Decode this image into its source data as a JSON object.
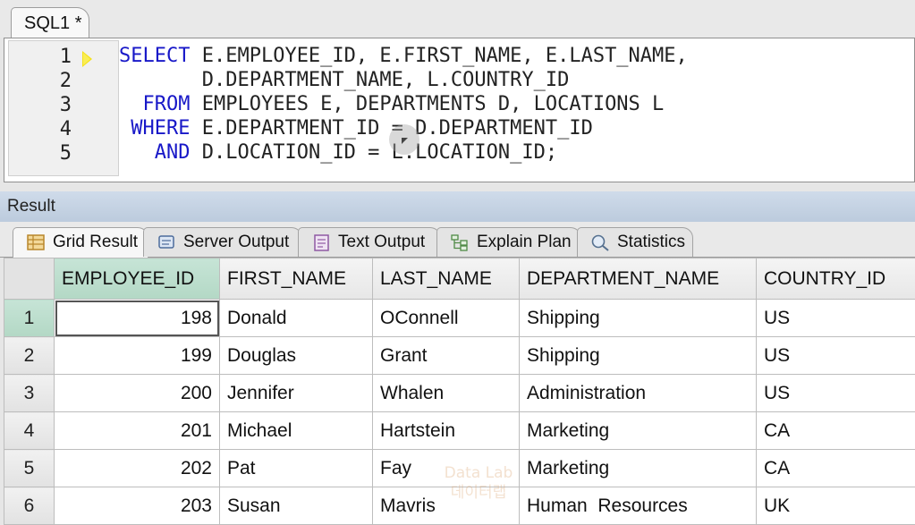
{
  "editor": {
    "tab_label": "SQL1 *",
    "line_numbers": [
      "1",
      "2",
      "3",
      "4",
      "5"
    ],
    "lines": [
      {
        "indent": "",
        "keyword": "SELECT",
        "text": " E.EMPLOYEE_ID, E.FIRST_NAME, E.LAST_NAME,"
      },
      {
        "indent": "       ",
        "keyword": "",
        "text": "D.DEPARTMENT_NAME, L.COUNTRY_ID"
      },
      {
        "indent": "  ",
        "keyword": "FROM",
        "text": " EMPLOYEES E, DEPARTMENTS D, LOCATIONS L"
      },
      {
        "indent": " ",
        "keyword": "WHERE",
        "text": " E.DEPARTMENT_ID = D.DEPARTMENT_ID"
      },
      {
        "indent": "   ",
        "keyword": "AND",
        "text": " D.LOCATION_ID = L.LOCATION_ID;"
      }
    ],
    "keyword_color": "#1818c8"
  },
  "result": {
    "label": "Result",
    "tabs": [
      {
        "label": "Grid Result",
        "icon": "grid-icon"
      },
      {
        "label": "Server Output",
        "icon": "server-icon"
      },
      {
        "label": "Text Output",
        "icon": "text-document-icon"
      },
      {
        "label": "Explain Plan",
        "icon": "explain-plan-icon"
      },
      {
        "label": "Statistics",
        "icon": "statistics-icon"
      }
    ],
    "active_tab": "Grid Result"
  },
  "grid": {
    "columns": [
      "EMPLOYEE_ID",
      "FIRST_NAME",
      "LAST_NAME",
      "DEPARTMENT_NAME",
      "COUNTRY_ID"
    ],
    "rows": [
      {
        "row": "1",
        "cells": [
          "198",
          "Donald",
          "OConnell",
          "Shipping",
          "US"
        ]
      },
      {
        "row": "2",
        "cells": [
          "199",
          "Douglas",
          "Grant",
          "Shipping",
          "US"
        ]
      },
      {
        "row": "3",
        "cells": [
          "200",
          "Jennifer",
          "Whalen",
          "Administration",
          "US"
        ]
      },
      {
        "row": "4",
        "cells": [
          "201",
          "Michael",
          "Hartstein",
          "Marketing",
          "CA"
        ]
      },
      {
        "row": "5",
        "cells": [
          "202",
          "Pat",
          "Fay",
          "Marketing",
          "CA"
        ]
      },
      {
        "row": "6",
        "cells": [
          "203",
          "Susan",
          "Mavris",
          "Human  Resources",
          "UK"
        ]
      }
    ],
    "selected_row": "1",
    "highlight_color": "#b9dccb"
  },
  "watermark": {
    "line1": "Data Lab",
    "line2": "데이터랩"
  }
}
